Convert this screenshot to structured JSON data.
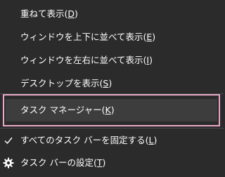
{
  "menu": {
    "items": [
      {
        "label": "重ねて表示(",
        "key": "D",
        "end": ")"
      },
      {
        "label": "ウィンドウを上下に並べて表示(",
        "key": "E",
        "end": ")"
      },
      {
        "label": "ウィンドウを左右に並べて表示(",
        "key": "I",
        "end": ")"
      },
      {
        "label": "デスクトップを表示(",
        "key": "S",
        "end": ")"
      },
      {
        "label": "タスク マネージャー(",
        "key": "K",
        "end": ")"
      },
      {
        "label": "すべてのタスク バーを固定する(",
        "key": "L",
        "end": ")"
      },
      {
        "label": "タスク バーの設定(",
        "key": "T",
        "end": ")"
      }
    ],
    "icons": {
      "lock_all": "checkmark-icon",
      "settings": "gear-icon"
    },
    "colors": {
      "background": "#2b2b2b",
      "text": "#ffffff",
      "highlight_border": "#e8a8c8",
      "hover_background": "#3d3d3d"
    }
  }
}
